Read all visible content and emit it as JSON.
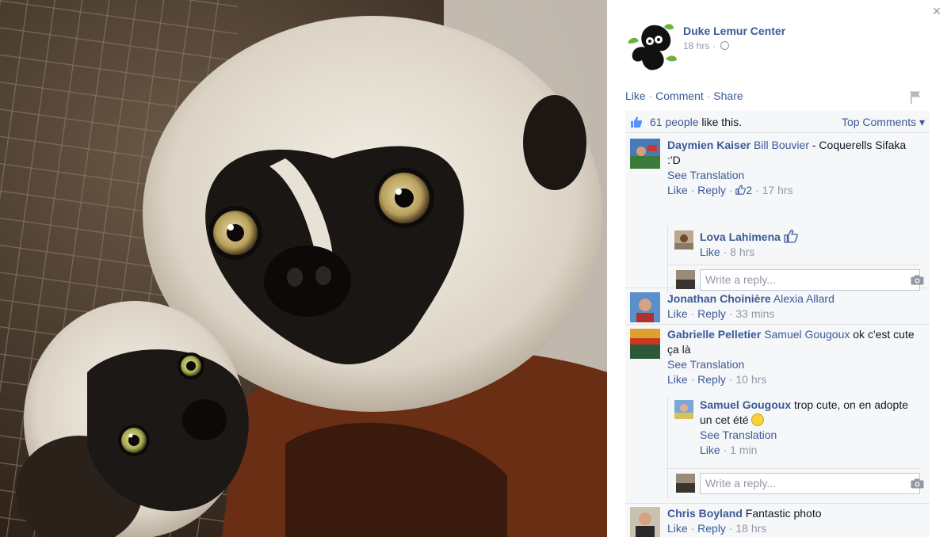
{
  "window": {
    "close_glyph": "×"
  },
  "post": {
    "page_name": "Duke Lemur Center",
    "time": "18 hrs",
    "separator": "·",
    "actions": {
      "like": "Like",
      "comment": "Comment",
      "share": "Share"
    },
    "likes_count": "61 people",
    "likes_suffix": " like this.",
    "top_comments": "Top Comments ▾"
  },
  "comments": [
    {
      "author": "Daymien Kaiser",
      "tag": "Bill Bouvier",
      "text": " - Coquerells Sifaka :'D",
      "see_translation": "See Translation",
      "like": "Like",
      "reply": "Reply",
      "like_count": "2",
      "time": "17 hrs",
      "replies": [
        {
          "author": "Lova Lahimena",
          "like": "Like",
          "time": "8 hrs"
        }
      ],
      "reply_placeholder": "Write a reply..."
    },
    {
      "author": "Jonathan Choinière",
      "tag": "Alexia Allard",
      "like": "Like",
      "reply": "Reply",
      "time": "33 mins"
    },
    {
      "author": "Gabrielle Pelletier",
      "tag": "Samuel Gougoux",
      "text": " ok c'est cute ça là",
      "see_translation": "See Translation",
      "like": "Like",
      "reply": "Reply",
      "time": "10 hrs",
      "replies": [
        {
          "author": "Samuel Gougoux",
          "text": " trop cute, on en adopte un cet été",
          "see_translation": "See Translation",
          "like": "Like",
          "time": "1 min"
        }
      ],
      "reply_placeholder": "Write a reply..."
    },
    {
      "author": "Chris Boyland",
      "text": " Fantastic photo",
      "like": "Like",
      "reply": "Reply",
      "time": "18 hrs"
    }
  ],
  "colors": {
    "link": "#3b5998",
    "muted": "#9197a3",
    "panel": "#f6f7f9"
  }
}
